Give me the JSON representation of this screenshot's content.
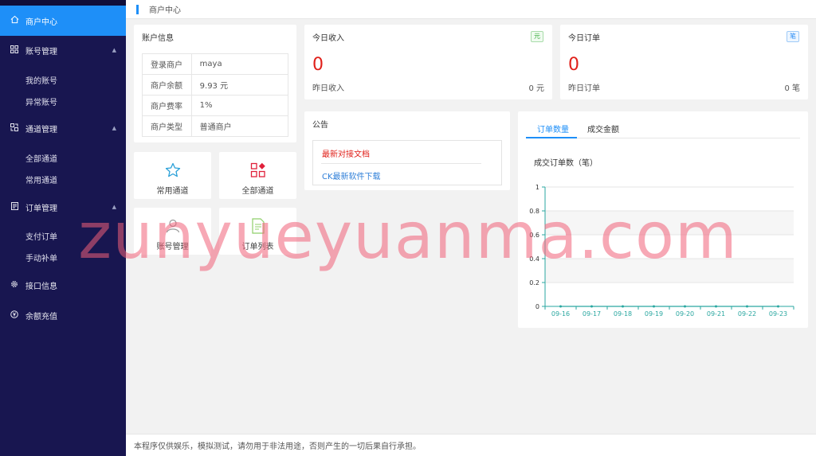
{
  "sidebar": {
    "items": [
      {
        "label": "商户中心",
        "icon": "home-icon"
      },
      {
        "label": "账号管理",
        "icon": "grid-icon"
      },
      {
        "label": "我的账号"
      },
      {
        "label": "异常账号"
      },
      {
        "label": "通道管理",
        "icon": "channel-icon"
      },
      {
        "label": "全部通道"
      },
      {
        "label": "常用通道"
      },
      {
        "label": "订单管理",
        "icon": "doc-icon"
      },
      {
        "label": "支付订单"
      },
      {
        "label": "手动补单"
      },
      {
        "label": "接口信息",
        "icon": "gear-icon"
      },
      {
        "label": "余额充值",
        "icon": "yen-icon"
      }
    ]
  },
  "header": {
    "breadcrumb": "商户中心"
  },
  "account": {
    "title": "账户信息",
    "rows": [
      {
        "k": "登录商户",
        "v": "maya"
      },
      {
        "k": "商户余额",
        "v": "9.93 元"
      },
      {
        "k": "商户费率",
        "v": "1%"
      },
      {
        "k": "商户类型",
        "v": "普通商户"
      }
    ]
  },
  "shortcuts": [
    {
      "label": "常用通道",
      "icon": "star-icon"
    },
    {
      "label": "全部通道",
      "icon": "apps-icon"
    },
    {
      "label": "账号管理",
      "icon": "user-icon"
    },
    {
      "label": "订单列表",
      "icon": "list-doc-icon"
    }
  ],
  "today_income": {
    "title": "今日收入",
    "badge": "元",
    "value": "0",
    "foot_label": "昨日收入",
    "foot_value": "0 元"
  },
  "today_orders": {
    "title": "今日订单",
    "badge": "笔",
    "value": "0",
    "foot_label": "昨日订单",
    "foot_value": "0 笔"
  },
  "notice": {
    "title": "公告",
    "links": [
      {
        "text": "最新对接文档",
        "color": "#e0201a"
      },
      {
        "text": "CK最新软件下载",
        "color": "#2f7fd8"
      }
    ]
  },
  "chart_card": {
    "tabs": [
      "订单数量",
      "成交金额"
    ],
    "active_tab": 0
  },
  "chart_data": {
    "type": "line",
    "title": "成交订单数（笔）",
    "categories": [
      "09-16",
      "09-17",
      "09-18",
      "09-19",
      "09-20",
      "09-21",
      "09-22",
      "09-23"
    ],
    "values": [
      0,
      0,
      0,
      0,
      0,
      0,
      0,
      0
    ],
    "yticks": [
      "0",
      "0.2",
      "0.4",
      "0.6",
      "0.8",
      "1"
    ],
    "ylim": [
      0,
      1
    ],
    "grid": true,
    "axis_color": "#2aa7a0"
  },
  "watermark": "zunyueyuanma.com",
  "footer": {
    "text": "本程序仅供娱乐，模拟测试，请勿用于非法用途，否则产生的一切后果自行承担。"
  },
  "colors": {
    "sidebar": "#181650",
    "accent": "#1e8ff8",
    "value_red": "#e0201a"
  }
}
